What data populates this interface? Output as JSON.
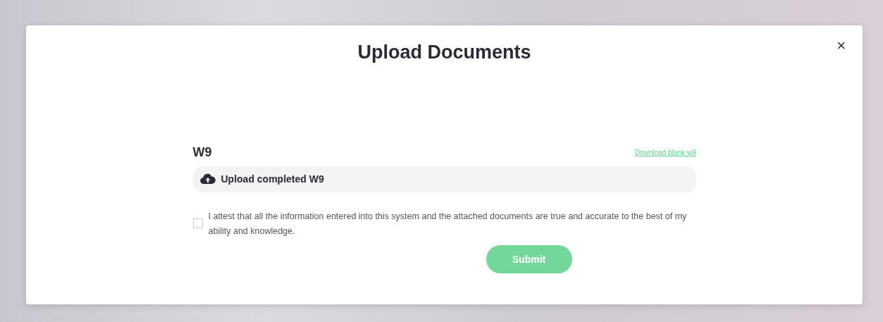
{
  "modal": {
    "title": "Upload Documents",
    "close": "×"
  },
  "document": {
    "name": "W9",
    "download_link": "Download blank w9",
    "upload_status": "Upload completed W9"
  },
  "attestation": {
    "text": "I attest that all the information entered into this system and the attached documents are true and accurate to the best of my ability and knowledge.",
    "checked": false
  },
  "submit": {
    "label": "Submit",
    "disabled": true
  }
}
